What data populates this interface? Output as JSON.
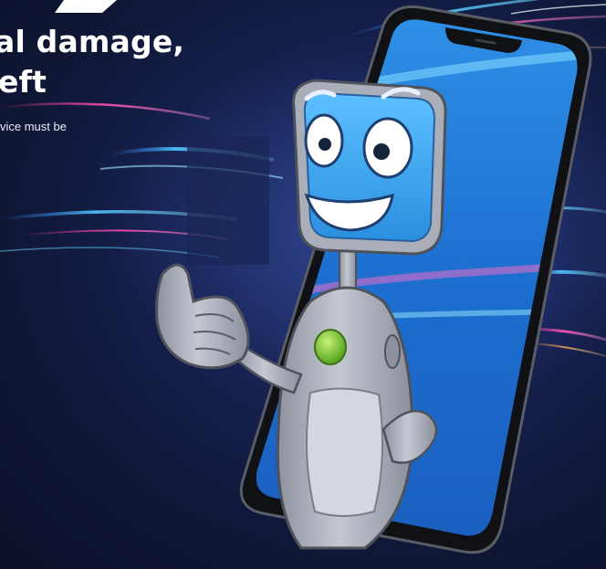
{
  "hero": {
    "headline_line1": "al damage,",
    "headline_line2": "eft",
    "subtext": "vice must be"
  },
  "colors": {
    "background": "#111a3d",
    "accent_blue": "#1f8fff",
    "light_streak": "#5fd2ff",
    "magenta_streak": "#d440b8",
    "robot_screen": "#3aa0e8",
    "robot_body": "#a9adb8",
    "robot_button": "#7ac943"
  },
  "illustration": {
    "device": "smartphone",
    "mascot": "robot-mascot",
    "mascot_gesture": "thumbs-up"
  }
}
